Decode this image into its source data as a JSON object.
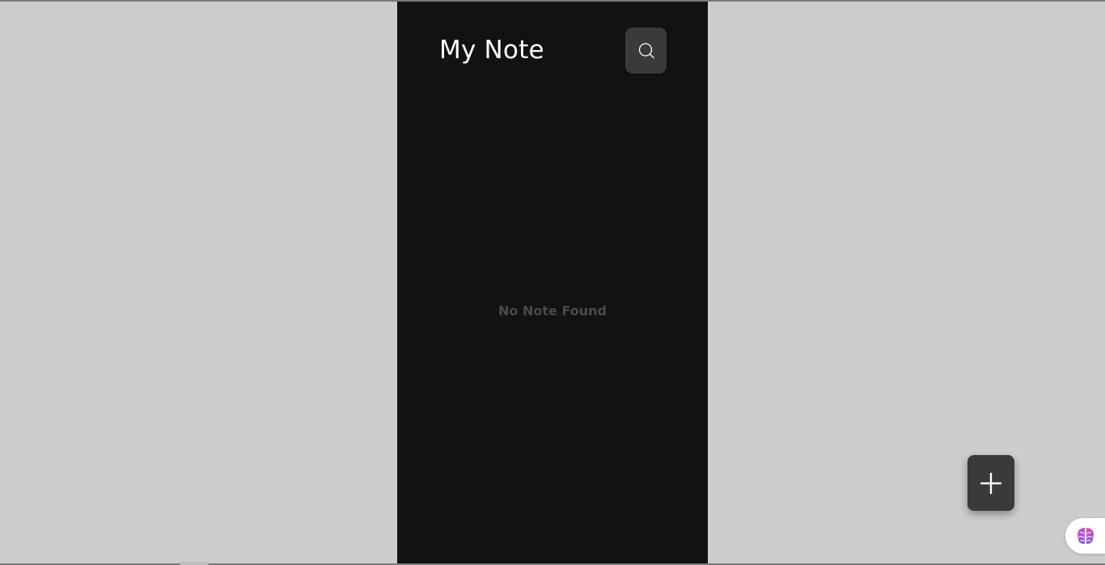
{
  "app": {
    "title": "My Note"
  },
  "header": {
    "search_icon": "search-icon"
  },
  "main": {
    "empty_message": "No Note Found"
  },
  "fab": {
    "icon": "plus-icon"
  },
  "extension": {
    "icon": "brain-icon"
  },
  "colors": {
    "page_background": "#cdcdcd",
    "app_background": "#121212",
    "button_background": "#3a3a3a",
    "title_text": "#ffffff",
    "empty_text": "#4a4a4a"
  }
}
